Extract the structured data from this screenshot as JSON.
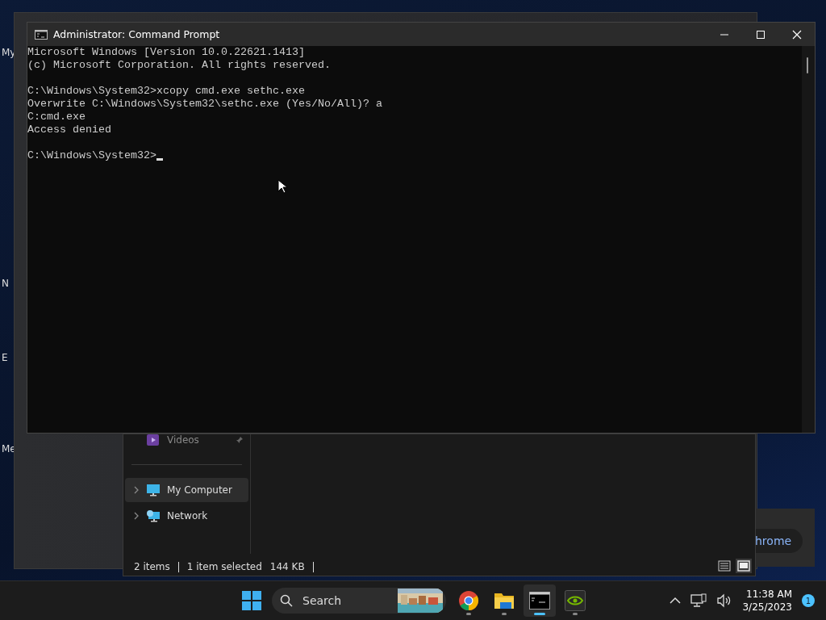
{
  "desktop": {
    "icon_labels": [
      "My",
      "N",
      "E",
      "Me"
    ]
  },
  "back_window": {
    "button_text": "hrome"
  },
  "explorer": {
    "nav_items": [
      {
        "label": "Videos",
        "kind": "video",
        "pinned": true,
        "selected": false,
        "expandable": false
      },
      {
        "label": "My Computer",
        "kind": "computer",
        "pinned": false,
        "selected": true,
        "expandable": true
      },
      {
        "label": "Network",
        "kind": "network",
        "pinned": false,
        "selected": false,
        "expandable": true
      }
    ],
    "status": {
      "item_count": "2 items",
      "selection": "1 item selected",
      "size": "144 KB"
    },
    "views": [
      {
        "kind": "details",
        "selected": false
      },
      {
        "kind": "tiles",
        "selected": true
      }
    ]
  },
  "cmd_window": {
    "title": "Administrator: Command Prompt",
    "output_blocks": [
      [
        "Microsoft Windows [Version 10.0.22621.1413]",
        "(c) Microsoft Corporation. All rights reserved."
      ],
      [
        "C:\\Windows\\System32>xcopy cmd.exe sethc.exe",
        "Overwrite C:\\Windows\\System32\\sethc.exe (Yes/No/All)? a",
        "C:cmd.exe",
        "Access denied"
      ]
    ],
    "prompt": "C:\\Windows\\System32>"
  },
  "taskbar": {
    "search_placeholder": "Search",
    "apps": [
      {
        "kind": "chrome",
        "running": true,
        "selected": false
      },
      {
        "kind": "folder",
        "running": true,
        "selected": false
      },
      {
        "kind": "terminal",
        "running": true,
        "selected": true
      },
      {
        "kind": "nvidia",
        "running": true,
        "selected": false
      }
    ],
    "time": "11:38 AM",
    "date": "3/25/2023",
    "notification_count": "1"
  }
}
